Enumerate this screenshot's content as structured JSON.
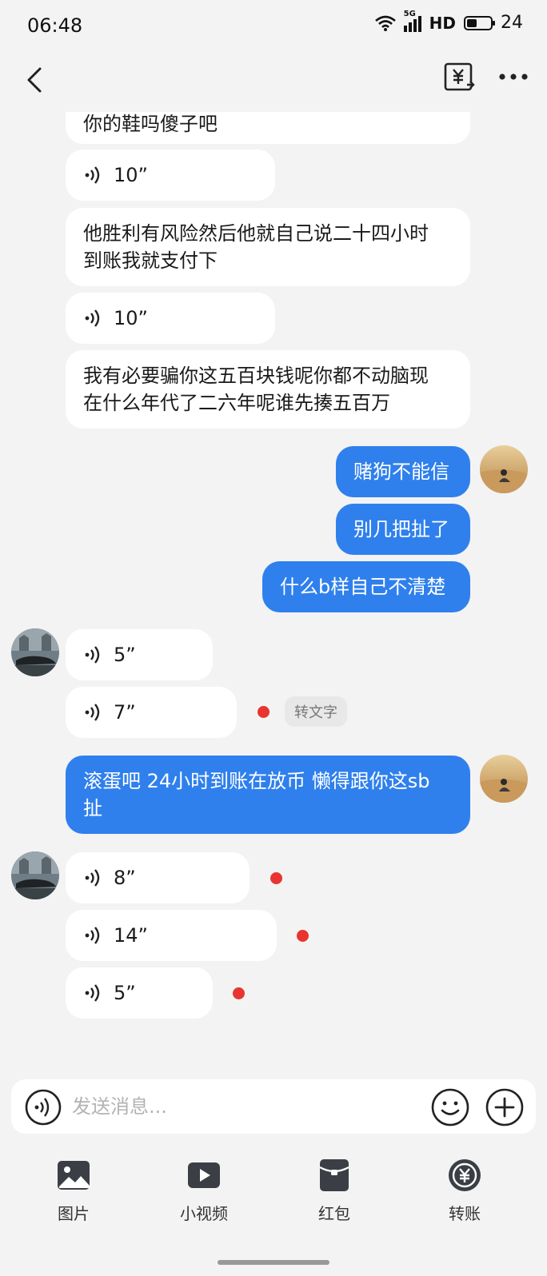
{
  "status_bar": {
    "time": "06:48",
    "network": "5G",
    "hd": "HD",
    "battery": "24"
  },
  "header": {
    "back_icon": "chevron-left-icon",
    "transfer_icon": "yuan-receipt-icon",
    "more_icon": "more-dots-icon"
  },
  "messages": [
    {
      "side": "in",
      "type": "text",
      "text": "你的鞋吗傻子吧"
    },
    {
      "side": "in",
      "type": "voice",
      "duration": "10”"
    },
    {
      "side": "in",
      "type": "text",
      "lines": [
        "他胜利有风险然后他就自己说二十四小时",
        "到账我就支付下"
      ]
    },
    {
      "side": "in",
      "type": "voice",
      "duration": "10”"
    },
    {
      "side": "in",
      "type": "text",
      "lines": [
        "我有必要骗你这五百块钱呢你都不动脑现",
        "在什么年代了二六年呢谁先揍五百万"
      ]
    },
    {
      "side": "out",
      "type": "text",
      "text": "赌狗不能信"
    },
    {
      "side": "out",
      "type": "text",
      "text": "别几把扯了"
    },
    {
      "side": "out",
      "type": "text",
      "text": "什么b样自己不清楚"
    },
    {
      "side": "in",
      "type": "voice",
      "duration": "5”"
    },
    {
      "side": "in",
      "type": "voice",
      "duration": "7”",
      "unread": true,
      "action": "转文字"
    },
    {
      "side": "out",
      "type": "text",
      "lines": [
        "滚蛋吧 24小时到账在放币 懒得跟你这sb",
        "扯"
      ]
    },
    {
      "side": "in",
      "type": "voice",
      "duration": "8”",
      "unread": true
    },
    {
      "side": "in",
      "type": "voice",
      "duration": "14”",
      "unread": true
    },
    {
      "side": "in",
      "type": "voice",
      "duration": "5”",
      "unread": true
    }
  ],
  "input": {
    "placeholder": "发送消息...",
    "voice_icon": "voice-icon",
    "emoji_icon": "emoji-icon",
    "plus_icon": "plus-icon"
  },
  "toolbar": [
    {
      "label": "图片",
      "icon": "image-icon"
    },
    {
      "label": "小视频",
      "icon": "video-icon"
    },
    {
      "label": "红包",
      "icon": "red-packet-icon"
    },
    {
      "label": "转账",
      "icon": "transfer-icon"
    }
  ],
  "colors": {
    "background": "#f3f3f3",
    "incoming_bubble": "#ffffff",
    "outgoing_bubble": "#2f80ed",
    "unread_dot": "#e8352f"
  }
}
